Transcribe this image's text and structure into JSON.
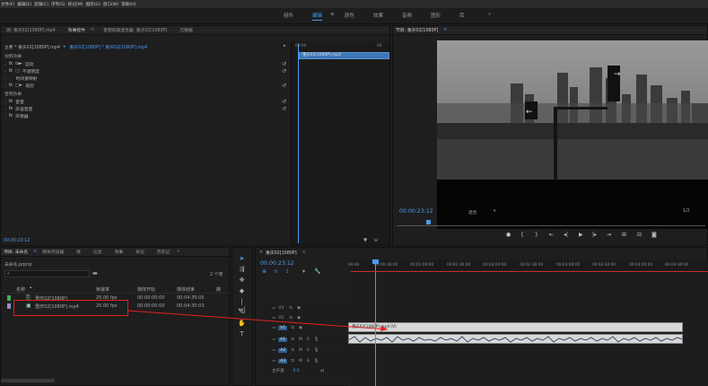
{
  "menu": [
    "文件(F)",
    "编辑(E)",
    "剪辑(C)",
    "序列(S)",
    "标记(M)",
    "图形(G)",
    "窗口(W)",
    "帮助(H)"
  ],
  "workspaces": {
    "items": [
      "组件",
      "编辑",
      "颜色",
      "效果",
      "音频",
      "图形",
      "库"
    ],
    "active": "编辑",
    "more": "»"
  },
  "effect_controls": {
    "tabs": [
      "源: 重庆02[1080P].mp4",
      "效果控件",
      "音频剪辑混合器: 重庆02[1080P]",
      "元数据"
    ],
    "breadcrumb_master": "主要 * 重庆02[1080P].mp4",
    "breadcrumb_sequence": "重庆02[1080P] * 重庆02[1080P].mp4",
    "video_section": "视频效果",
    "video_effects": [
      "运动",
      "不透明度",
      "时间重映射",
      "裁剪"
    ],
    "audio_section": "音频效果",
    "audio_effects": [
      "音量",
      "声道音量",
      "声像器"
    ],
    "mini_clip": "重庆02[1080P].mp4",
    "mini_time_start": "00:00",
    "mini_time_end": "00",
    "timecode": "00:00:23:12"
  },
  "program_monitor": {
    "title": "节目: 重庆02[1080P]",
    "timecode": "00:00:23:12",
    "fit": "适合",
    "fraction": "1/2"
  },
  "project": {
    "tabs": [
      "项目: 未命名",
      "媒体浏览器",
      "库",
      "信息",
      "效果",
      "标记",
      "历史记"
    ],
    "project_file": "未命名.prproj",
    "item_count": "2 个项",
    "columns": [
      "名称",
      "帧速率",
      "媒体开始",
      "媒体结束",
      "媒"
    ],
    "rows": [
      {
        "name": "重庆02[1080P]",
        "fps": "25.00 fps",
        "start": "00:00:00:00",
        "end": "00:04:35:05",
        "color": "#3fb24a"
      },
      {
        "name": "重庆02[1080P].mp4",
        "fps": "25.00 fps",
        "start": "00:00:00:00",
        "end": "00:04:35:03",
        "color": "#9a8cc8"
      }
    ]
  },
  "timeline": {
    "title": "重庆02[1080P]",
    "timecode": "00:00:23:12",
    "ruler": [
      "00:00",
      "00:00:30:00",
      "00:01:00:00",
      "00:01:30:00",
      "00:02:00:00",
      "00:02:30:00",
      "00:03:00:00",
      "00:03:30:00",
      "00:04:00:00",
      "00:04:30:00"
    ],
    "tracks": [
      "V3",
      "V2",
      "V1",
      "A1",
      "A2",
      "A3"
    ],
    "track_buttons": [
      "M",
      "S"
    ],
    "master_label": "主声道",
    "master_value": "0.0",
    "clip_label": "重庆02[1080P].mp4 [V]"
  },
  "colors": {
    "accent": "#4a9cf0",
    "annotation": "#e02020",
    "playhead": "#4a9cf0"
  }
}
